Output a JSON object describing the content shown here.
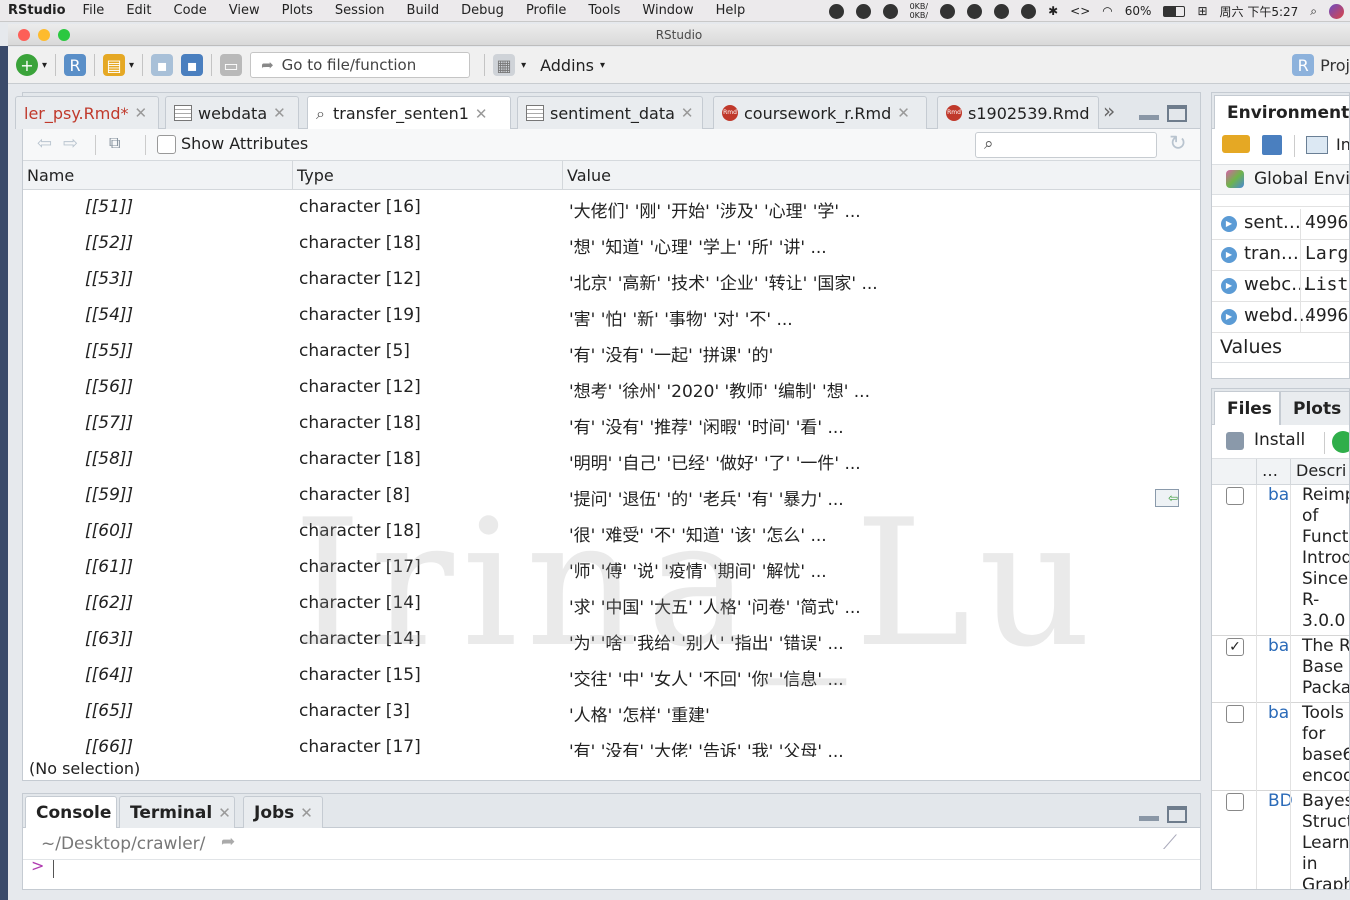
{
  "menubar": {
    "app": "RStudio",
    "items": [
      "File",
      "Edit",
      "Code",
      "View",
      "Plots",
      "Session",
      "Build",
      "Debug",
      "Profile",
      "Tools",
      "Window",
      "Help"
    ],
    "net_up": "0KB/",
    "net_down": "0KB/",
    "battery": "60%",
    "clock": "周六 下午5:27"
  },
  "window": {
    "title": "RStudio"
  },
  "toolbar": {
    "goto_placeholder": "Go to file/function",
    "addins_label": "Addins",
    "project_label": "Proj"
  },
  "editor_tabs": [
    {
      "label": "ler_psy.Rmd*",
      "icon": "rmd-icon",
      "active": false
    },
    {
      "label": "webdata",
      "icon": "table-icon",
      "active": false
    },
    {
      "label": "transfer_senten1",
      "icon": "search-icon",
      "active": true
    },
    {
      "label": "sentiment_data",
      "icon": "table-icon",
      "active": false
    },
    {
      "label": "coursework_r.Rmd",
      "icon": "rmd-icon",
      "active": false
    },
    {
      "label": "s1902539.Rmd",
      "icon": "rmd-icon",
      "active": false
    }
  ],
  "viewer": {
    "show_attributes_label": "Show Attributes",
    "columns": {
      "name": "Name",
      "type": "Type",
      "value": "Value"
    },
    "rows": [
      {
        "name": "[[51]]",
        "type": "character [16]",
        "value": "'大佬们' '刚' '开始' '涉及' '心理' '学' ..."
      },
      {
        "name": "[[52]]",
        "type": "character [18]",
        "value": "'想' '知道' '心理' '学上' '所' '讲' ..."
      },
      {
        "name": "[[53]]",
        "type": "character [12]",
        "value": "'北京' '高新' '技术' '企业' '转让' '国家' ..."
      },
      {
        "name": "[[54]]",
        "type": "character [19]",
        "value": "'害' '怕' '新' '事物' '对' '不' ..."
      },
      {
        "name": "[[55]]",
        "type": "character [5]",
        "value": "'有' '没有' '一起' '拼课' '的'"
      },
      {
        "name": "[[56]]",
        "type": "character [12]",
        "value": "'想考' '徐州' '2020' '教师' '编制' '想' ..."
      },
      {
        "name": "[[57]]",
        "type": "character [18]",
        "value": "'有' '没有' '推荐' '闲暇' '时间' '看' ..."
      },
      {
        "name": "[[58]]",
        "type": "character [18]",
        "value": "'明明' '自己' '已经' '做好' '了' '一件' ..."
      },
      {
        "name": "[[59]]",
        "type": "character [8]",
        "value": "'提问' '退伍' '的' '老兵' '有' '暴力' ..."
      },
      {
        "name": "[[60]]",
        "type": "character [18]",
        "value": "'很' '难受' '不' '知道' '该' '怎么' ..."
      },
      {
        "name": "[[61]]",
        "type": "character [17]",
        "value": "'师' '傅' '说' '疫情' '期间' '解忧' ..."
      },
      {
        "name": "[[62]]",
        "type": "character [14]",
        "value": "'求' '中国' '大五' '人格' '问卷' '简式' ..."
      },
      {
        "name": "[[63]]",
        "type": "character [14]",
        "value": "'为' '啥' '我给' '别人' '指出' '错误' ..."
      },
      {
        "name": "[[64]]",
        "type": "character [15]",
        "value": "'交往' '中' '女人' '不回' '你' '信息' ..."
      },
      {
        "name": "[[65]]",
        "type": "character [3]",
        "value": "'人格' '怎样' '重建'"
      },
      {
        "name": "[[66]]",
        "type": "character [17]",
        "value": "'有' '没有' '大佬' '告诉' '我' '父母' ..."
      }
    ],
    "status": "(No selection)",
    "watermark": "Irina_Lu"
  },
  "console": {
    "tabs": [
      {
        "label": "Console",
        "closable": false
      },
      {
        "label": "Terminal",
        "closable": true
      },
      {
        "label": "Jobs",
        "closable": true
      }
    ],
    "path": "~/Desktop/crawler/",
    "prompt": ">"
  },
  "environment": {
    "tab": "Environment",
    "import_label": "In",
    "scope": "Global Envir",
    "rows": [
      {
        "name": "sent…",
        "value": "4996"
      },
      {
        "name": "tran…",
        "value": "Larg"
      },
      {
        "name": "webc…",
        "value": "List"
      },
      {
        "name": "webd…",
        "value": "4996"
      }
    ],
    "section": "Values"
  },
  "files": {
    "tabs": [
      "Files",
      "Plots"
    ],
    "install_label": "Install",
    "col_dots": "…",
    "col_desc": "Descri",
    "packages": [
      {
        "name": "ba",
        "checked": false,
        "desc": [
          "Reimp",
          "of",
          "Funct",
          "Introd",
          "Since",
          "R-",
          "3.0.0"
        ]
      },
      {
        "name": "ba",
        "checked": true,
        "desc": [
          "The R",
          "Base",
          "Packa"
        ]
      },
      {
        "name": "ba",
        "checked": false,
        "desc": [
          "Tools",
          "for",
          "base6",
          "encod"
        ]
      },
      {
        "name": "BD",
        "checked": false,
        "desc": [
          "Bayes",
          "Struct",
          "Learn",
          "in",
          "Graph"
        ]
      }
    ]
  },
  "colors": {
    "accent": "#2a6ab8",
    "rmd": "#c0392b",
    "dot": "#5b9bd5"
  }
}
